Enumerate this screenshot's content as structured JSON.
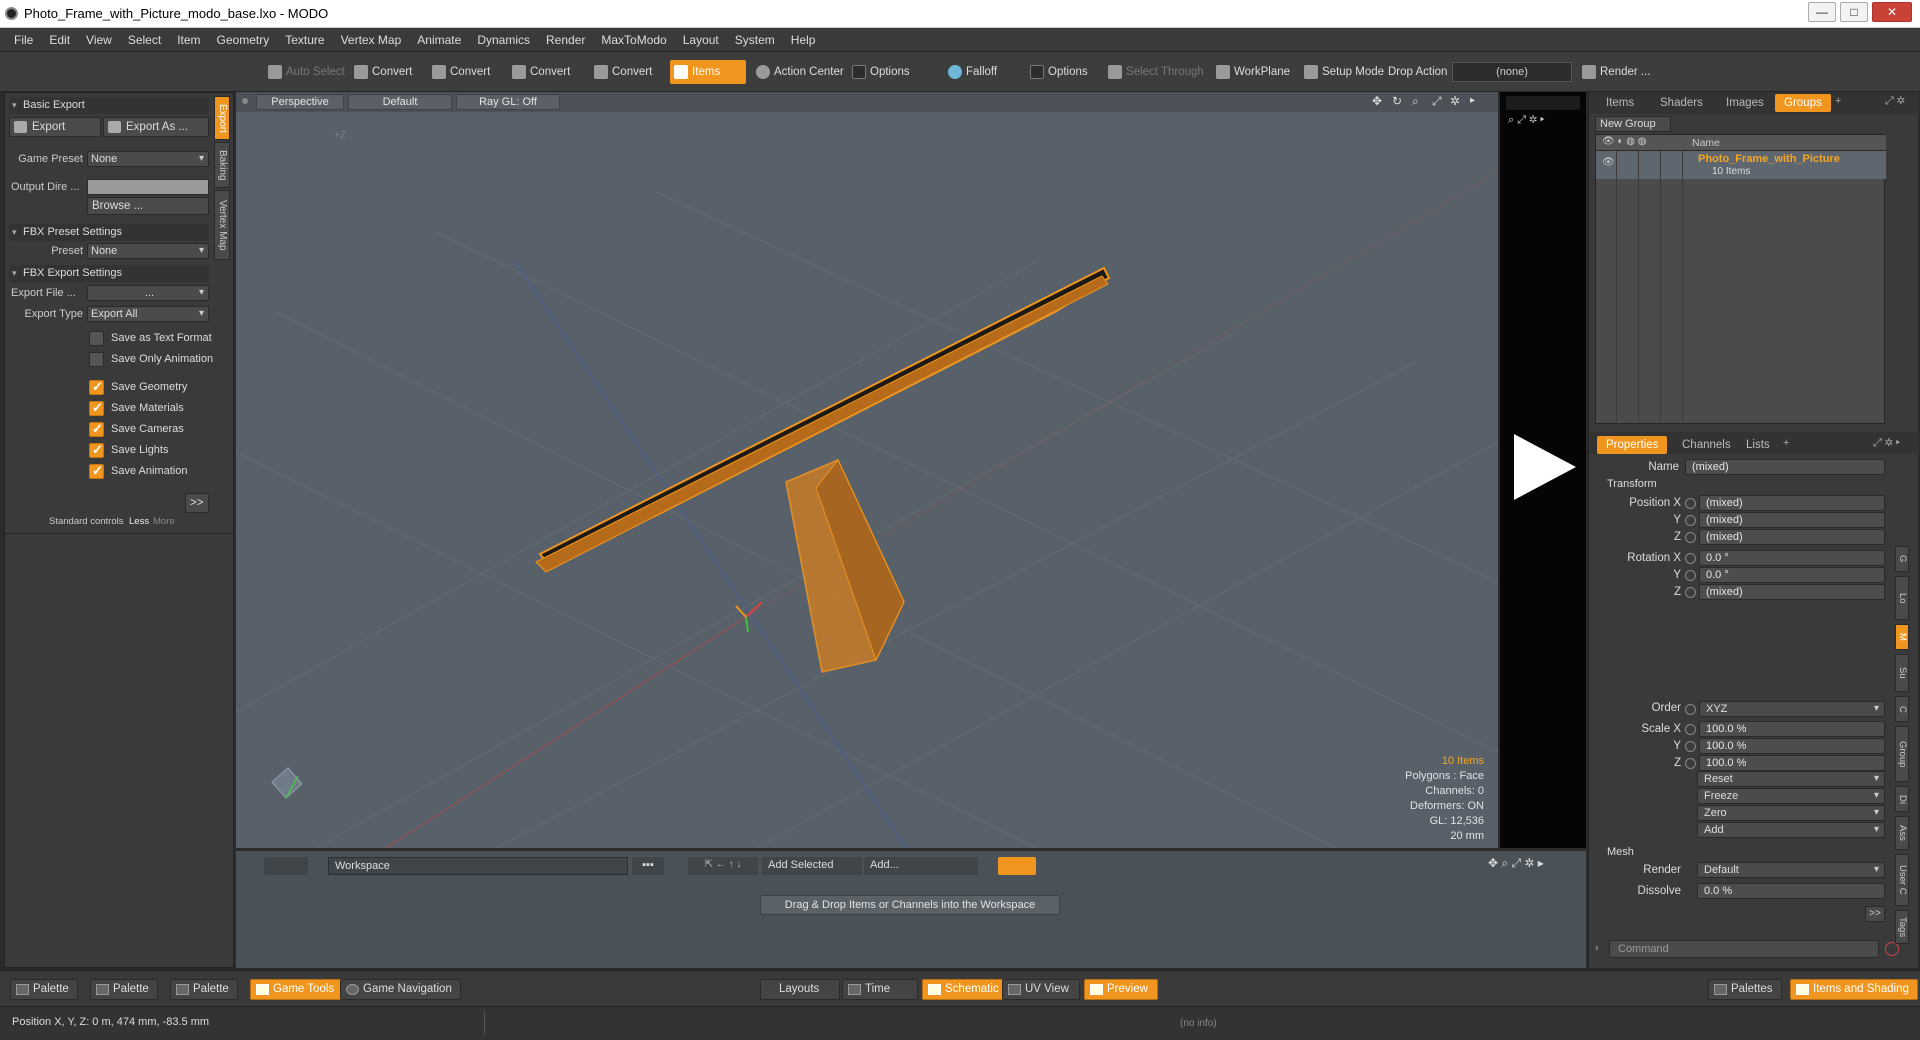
{
  "window": {
    "title": "Photo_Frame_with_Picture_modo_base.lxo - MODO",
    "minimize": "—",
    "maximize": "□",
    "close": "✕"
  },
  "menu": [
    "File",
    "Edit",
    "View",
    "Select",
    "Item",
    "Geometry",
    "Texture",
    "Vertex Map",
    "Animate",
    "Dynamics",
    "Render",
    "MaxToModo",
    "Layout",
    "System",
    "Help"
  ],
  "toolbar": {
    "auto_select": "Auto Select",
    "convert1": "Convert",
    "convert2": "Convert",
    "convert3": "Convert",
    "convert4": "Convert",
    "items": "Items",
    "action_center": "Action Center",
    "options1": "Options",
    "falloff": "Falloff",
    "options2": "Options",
    "select_through": "Select Through",
    "workplane": "WorkPlane",
    "setup_mode": "Setup Mode",
    "drop_action": "Drop Action",
    "drop_value": "(none)",
    "render": "Render ..."
  },
  "left": {
    "basic_export": "Basic Export",
    "export": "Export",
    "export_as": "Export As ...",
    "game_preset_label": "Game Preset",
    "game_preset_value": "None",
    "output_dir_label": "Output Dire ...",
    "browse": "Browse ...",
    "fbx_preset_settings": "FBX Preset Settings",
    "preset_label": "Preset",
    "preset_value": "None",
    "fbx_export_settings": "FBX Export Settings",
    "export_file_label": "Export File ...",
    "export_file_value": "...",
    "export_type_label": "Export Type",
    "export_type_value": "Export All",
    "checks": [
      {
        "label": "Save as Text Format",
        "checked": false
      },
      {
        "label": "Save Only Animation",
        "checked": false
      },
      {
        "label": "Save Geometry",
        "checked": true
      },
      {
        "label": "Save Materials",
        "checked": true
      },
      {
        "label": "Save Cameras",
        "checked": true
      },
      {
        "label": "Save Lights",
        "checked": true
      },
      {
        "label": "Save Animation",
        "checked": true
      }
    ],
    "more_btn": ">>",
    "standard_controls": "Standard controls",
    "less": "Less",
    "more": "More",
    "vtabs": [
      "Export",
      "Baking",
      "Vertex Map"
    ]
  },
  "viewport": {
    "perspective": "Perspective",
    "default": "Default",
    "raygl": "Ray GL: Off",
    "axis_label": "+Z",
    "info": {
      "items": "10 Items",
      "polygons": "Polygons : Face",
      "channels": "Channels: 0",
      "deformers": "Deformers: ON",
      "gl": "GL: 12,536",
      "scale": "20 mm"
    }
  },
  "workspace": {
    "dropdown": "Workspace",
    "add_selected": "Add Selected",
    "add": "Add...",
    "hint": "Drag & Drop Items or Channels into the Workspace"
  },
  "right": {
    "tabs": [
      "Items",
      "Shaders",
      "Images",
      "Groups"
    ],
    "new_group": "New Group",
    "col_name": "Name",
    "group_name": "Photo_Frame_with_Picture",
    "group_count": "10 Items",
    "ptabs": [
      "Properties",
      "Channels",
      "Lists"
    ],
    "name_label": "Name",
    "name_value": "(mixed)",
    "transform": "Transform",
    "rows": [
      {
        "label": "Position X",
        "value": "(mixed)"
      },
      {
        "label": "Y",
        "value": "(mixed)"
      },
      {
        "label": "Z",
        "value": "(mixed)"
      },
      {
        "label": "Rotation X",
        "value": "0.0 °"
      },
      {
        "label": "Y",
        "value": "0.0 °"
      },
      {
        "label": "Z",
        "value": "(mixed)"
      }
    ],
    "order_label": "Order",
    "order_value": "XYZ",
    "scale_rows": [
      {
        "label": "Scale X",
        "value": "100.0 %"
      },
      {
        "label": "Y",
        "value": "100.0 %"
      },
      {
        "label": "Z",
        "value": "100.0 %"
      }
    ],
    "reset": "Reset",
    "freeze": "Freeze",
    "zero": "Zero",
    "addbtn": "Add",
    "mesh": "Mesh",
    "render_label": "Render",
    "render_value": "Default",
    "dissolve_label": "Dissolve",
    "dissolve_value": "0.0 %",
    "more_btn": ">>",
    "command_placeholder": "Command",
    "vtabs": [
      "G",
      "Lo",
      "M",
      "Su",
      "C",
      "Group",
      "Di",
      "Ass",
      "User C",
      "Tags"
    ]
  },
  "bottom": {
    "palette1": "Palette",
    "palette2": "Palette",
    "palette3": "Palette",
    "game_tools": "Game Tools",
    "game_navigation": "Game Navigation",
    "layouts": "Layouts",
    "time": "Time",
    "schematic": "Schematic",
    "uv_view": "UV View",
    "preview": "Preview",
    "palettes": "Palettes",
    "items_shading": "Items and Shading"
  },
  "status": {
    "position": "Position X, Y, Z:  0 m, 474 mm, -83.5 mm",
    "info": "(no info)"
  },
  "colors": {
    "accent": "#f0961e",
    "viewport_bg": "#586069"
  }
}
